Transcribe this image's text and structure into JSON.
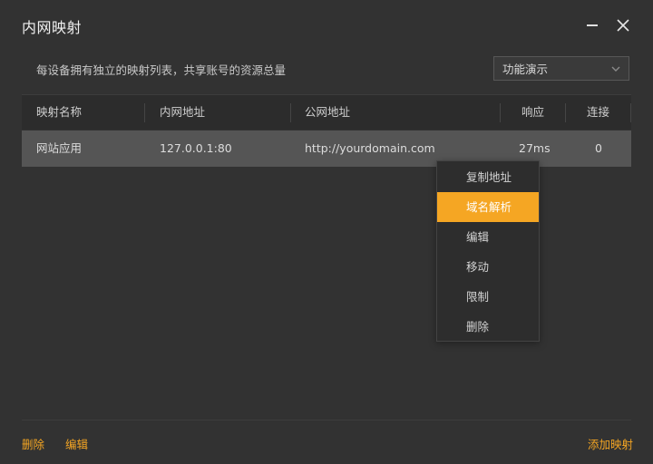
{
  "window": {
    "title": "内网映射"
  },
  "description": "每设备拥有独立的映射列表，共享账号的资源总量",
  "select": {
    "value": "功能演示"
  },
  "table": {
    "headers": [
      "映射名称",
      "内网地址",
      "公网地址",
      "响应",
      "连接"
    ],
    "rows": [
      {
        "name": "网站应用",
        "internal": "127.0.0.1:80",
        "public": "http://yourdomain.com",
        "latency": "27ms",
        "connections": "0"
      }
    ]
  },
  "context_menu": {
    "items": [
      "复制地址",
      "域名解析",
      "编辑",
      "移动",
      "限制",
      "删除"
    ],
    "highlighted_index": 1
  },
  "footer": {
    "delete_label": "删除",
    "edit_label": "编辑",
    "add_label": "添加映射"
  },
  "colors": {
    "accent": "#f5a623",
    "background": "#323232",
    "selected_row": "#555555"
  }
}
